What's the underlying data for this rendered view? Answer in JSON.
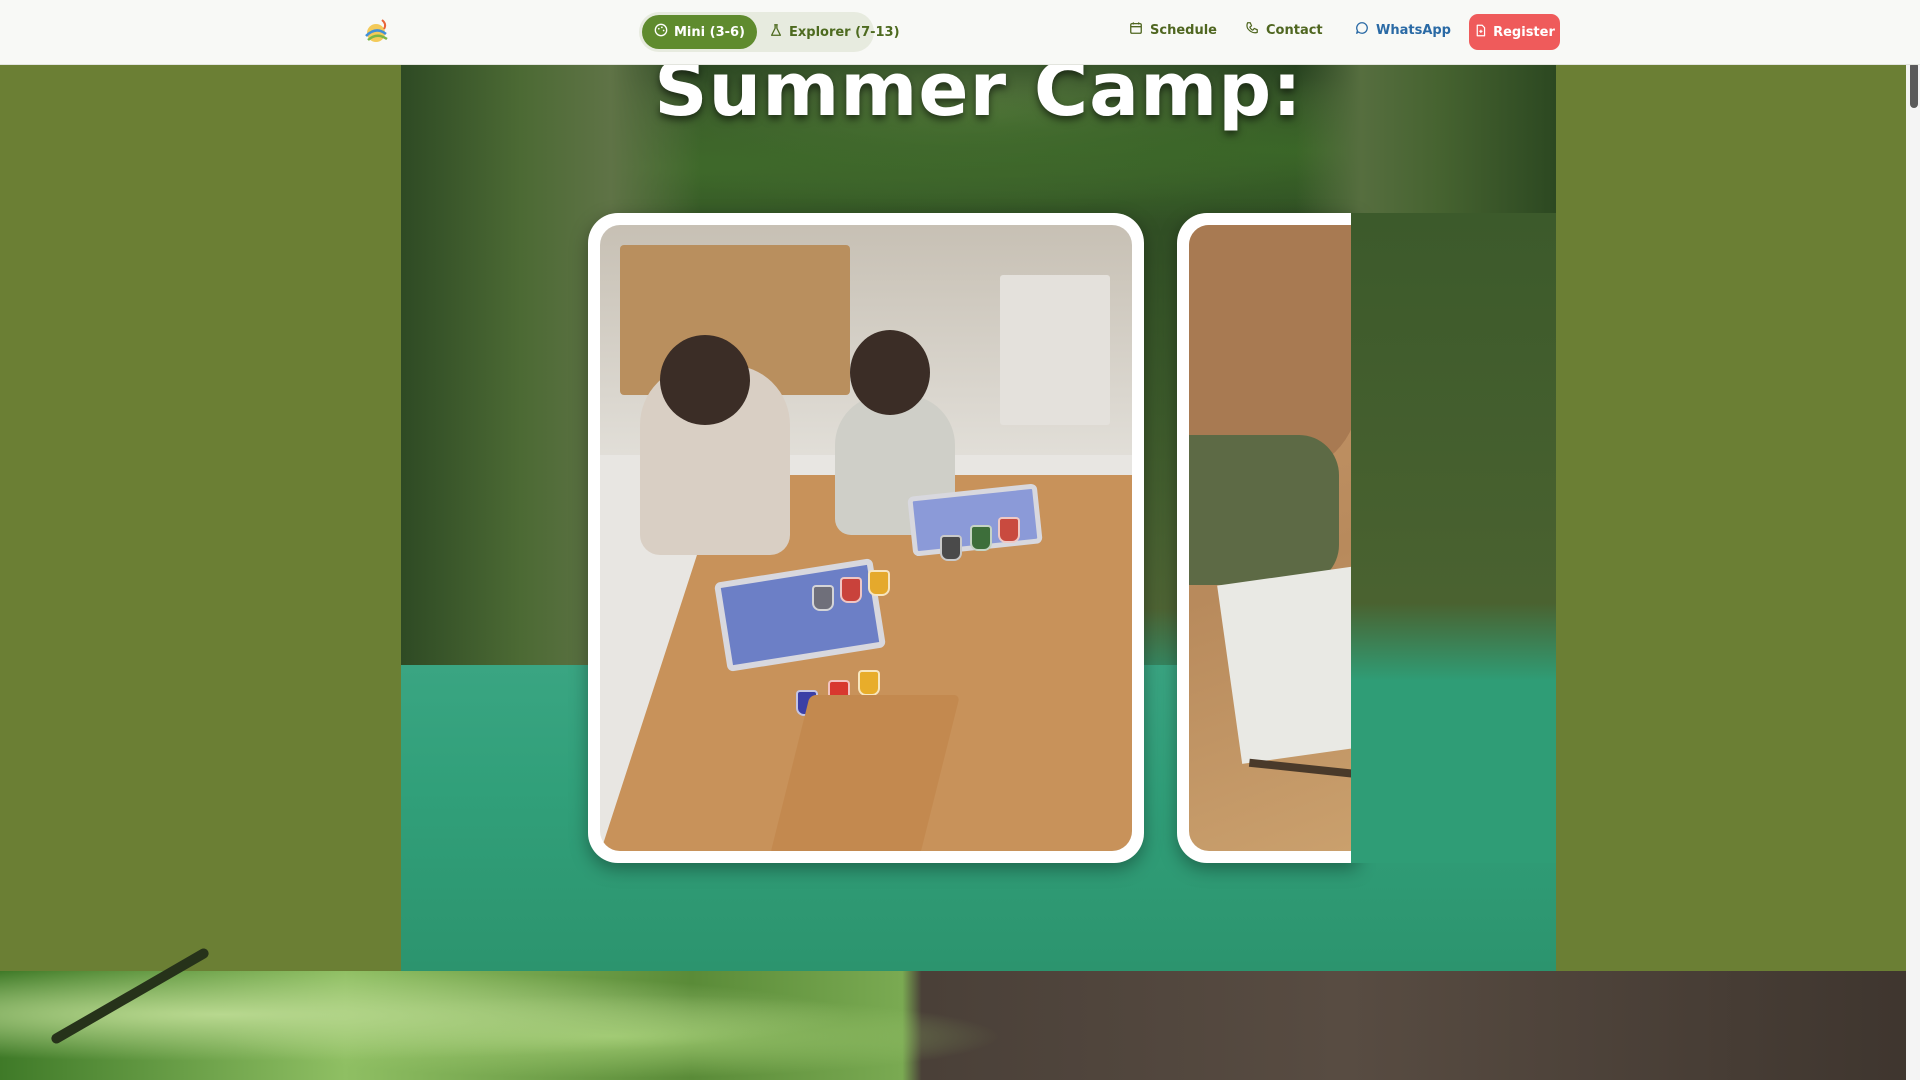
{
  "nav": {
    "logo_icon": "sun-logo-icon",
    "tabs": [
      {
        "label": "Mini (3-6)",
        "icon": "palette-icon",
        "active": true
      },
      {
        "label": "Explorer (7-13)",
        "icon": "flask-icon",
        "active": false
      }
    ],
    "links": [
      {
        "label": "Schedule",
        "icon": "calendar-icon"
      },
      {
        "label": "Contact",
        "icon": "phone-icon"
      },
      {
        "label": "WhatsApp",
        "icon": "chat-bubble-icon"
      }
    ],
    "register_label": "Register",
    "register_icon": "document-icon"
  },
  "hero": {
    "title": "Summer Camp:",
    "photos": [
      {
        "name": "children-painting-photo",
        "visible": "full"
      },
      {
        "name": "child-drawing-photo",
        "visible": "partial"
      }
    ]
  },
  "colors": {
    "page_background": "#6b7f34",
    "active_tab": "#5f8b2e",
    "nav_text": "#4f6620",
    "whatsapp_text": "#2a6aa5",
    "register_button": "#ef5b5b"
  }
}
